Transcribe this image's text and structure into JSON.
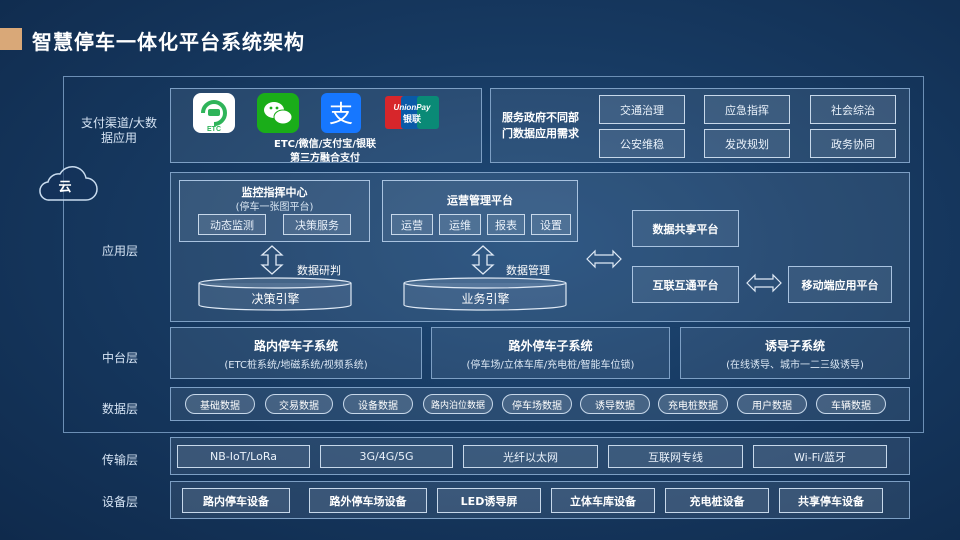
{
  "title": "智慧停车一体化平台系统架构",
  "layers": {
    "payment": "支付渠道/大数据应用",
    "cloud": "云",
    "app": "应用层",
    "middle": "中台层",
    "data": "数据层",
    "transport": "传输层",
    "device": "设备层"
  },
  "payment": {
    "icons": [
      "ETC",
      "微信",
      "支付宝",
      "UnionPay 银联"
    ],
    "caption": [
      "ETC/微信/支付宝/银联",
      "第三方融合支付"
    ]
  },
  "gov": {
    "desc": [
      "服务政府不同部",
      "门数据应用需求"
    ],
    "items": [
      "交通治理",
      "应急指挥",
      "社会综治",
      "公安维稳",
      "发改规划",
      "政务协同"
    ]
  },
  "monitor": {
    "title": "监控指挥中心",
    "subtitle": "(停车一张图平台)",
    "buttons": [
      "动态监测",
      "决策服务"
    ],
    "arrow_label": "数据研判",
    "engine": "决策引擎"
  },
  "ops": {
    "title": "运营管理平台",
    "buttons": [
      "运营",
      "运维",
      "报表",
      "设置"
    ],
    "arrow_label": "数据管理",
    "engine": "业务引擎"
  },
  "platforms": {
    "share": "数据共享平台",
    "interop": "互联互通平台",
    "mobile": "移动端应用平台"
  },
  "subsystems": [
    {
      "title": "路内停车子系统",
      "desc": "(ETC桩系统/地磁系统/视频系统)"
    },
    {
      "title": "路外停车子系统",
      "desc": "(停车场/立体车库/充电桩/智能车位锁)"
    },
    {
      "title": "诱导子系统",
      "desc": "(在线诱导、城市一二三级诱导)"
    }
  ],
  "data_items": [
    "基础数据",
    "交易数据",
    "设备数据",
    "路内泊位数据",
    "停车场数据",
    "诱导数据",
    "充电桩数据",
    "用户数据",
    "车辆数据"
  ],
  "transport_items": [
    "NB-IoT/LoRa",
    "3G/4G/5G",
    "光纤以太网",
    "互联网专线",
    "Wi-Fi/蓝牙"
  ],
  "device_items": [
    "路内停车设备",
    "路外停车场设备",
    "LED诱导屏",
    "立体车库设备",
    "充电桩设备",
    "共享停车设备"
  ],
  "colors": {
    "accent": "#d9a878",
    "etc": "#2fb45a",
    "wechat": "#1aad19",
    "alipay": "#1677ff",
    "unionpay_red": "#d7262b",
    "unionpay_blue": "#0a5aa8",
    "unionpay_green": "#0a8a76"
  }
}
